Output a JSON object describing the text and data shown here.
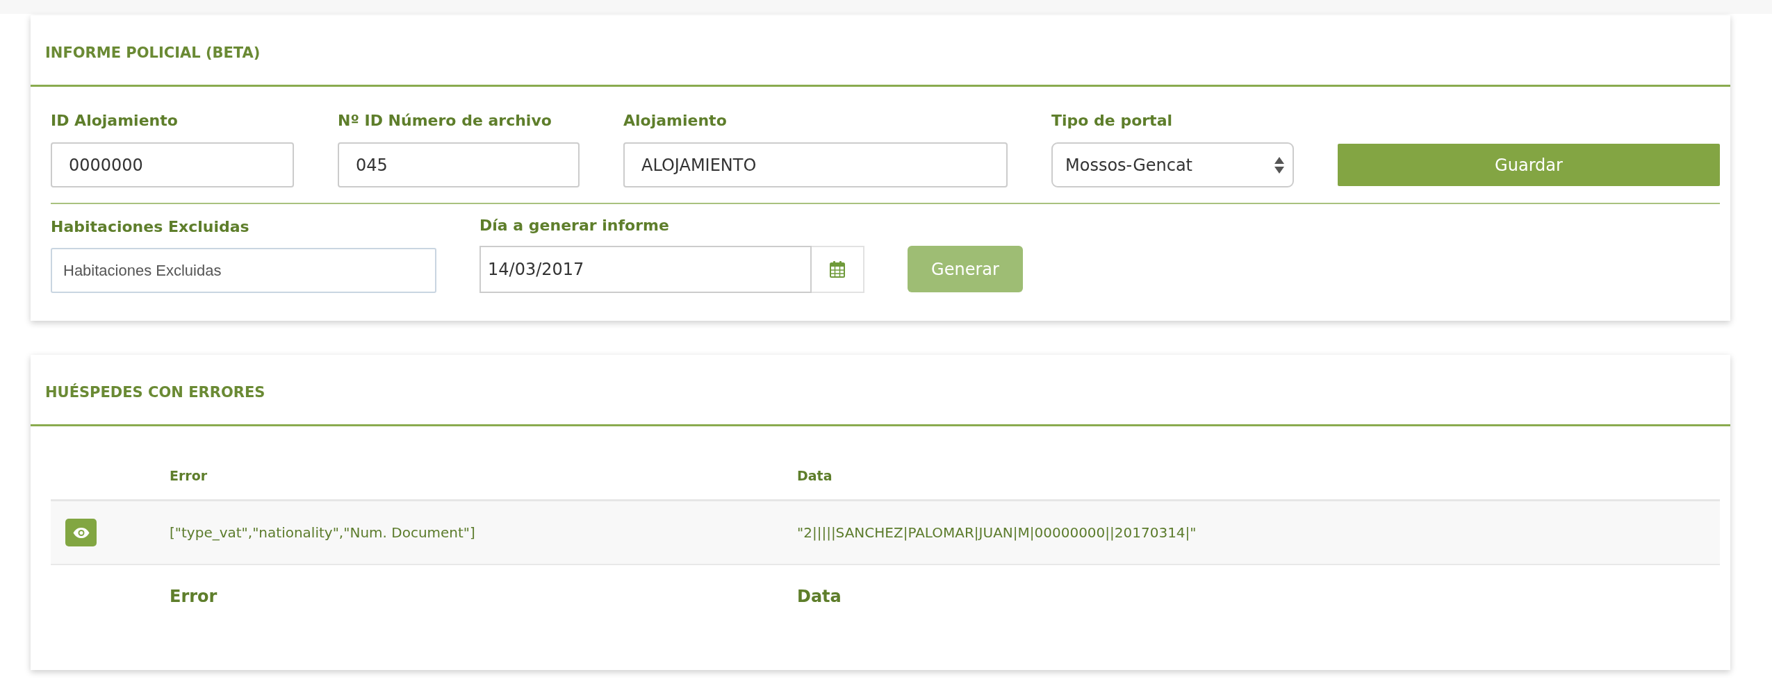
{
  "report_panel": {
    "title": "INFORME POLICIAL (BETA)",
    "fields": [
      {
        "kind": "text",
        "label": "ID Alojamiento",
        "value": "0000000"
      },
      {
        "kind": "text",
        "label": "Nº ID Número de archivo",
        "value": "045"
      },
      {
        "kind": "text",
        "label": "Alojamiento",
        "value": "ALOJAMIENTO"
      },
      {
        "kind": "select",
        "label": "Tipo de portal",
        "value": "Mossos-Gencat"
      }
    ],
    "save_button": "Guardar",
    "excluded_rooms": {
      "label": "Habitaciones Excluidas",
      "placeholder": "Habitaciones Excluidas"
    },
    "report_date": {
      "label": "Día a generar informe",
      "value": "14/03/2017"
    },
    "generate_button": {
      "label": "Generar",
      "disabled": true
    }
  },
  "errors_panel": {
    "title": "HUÉSPEDES CON ERRORES",
    "columns": [
      "Error",
      "Data"
    ],
    "rows": [
      {
        "error": "[\"type_vat\",\"nationality\",\"Num. Document\"]",
        "data": "\"2|||||SANCHEZ|PALOMAR|JUAN|M|00000000||20170314|\""
      }
    ],
    "footer": [
      "Error",
      "Data"
    ]
  }
}
